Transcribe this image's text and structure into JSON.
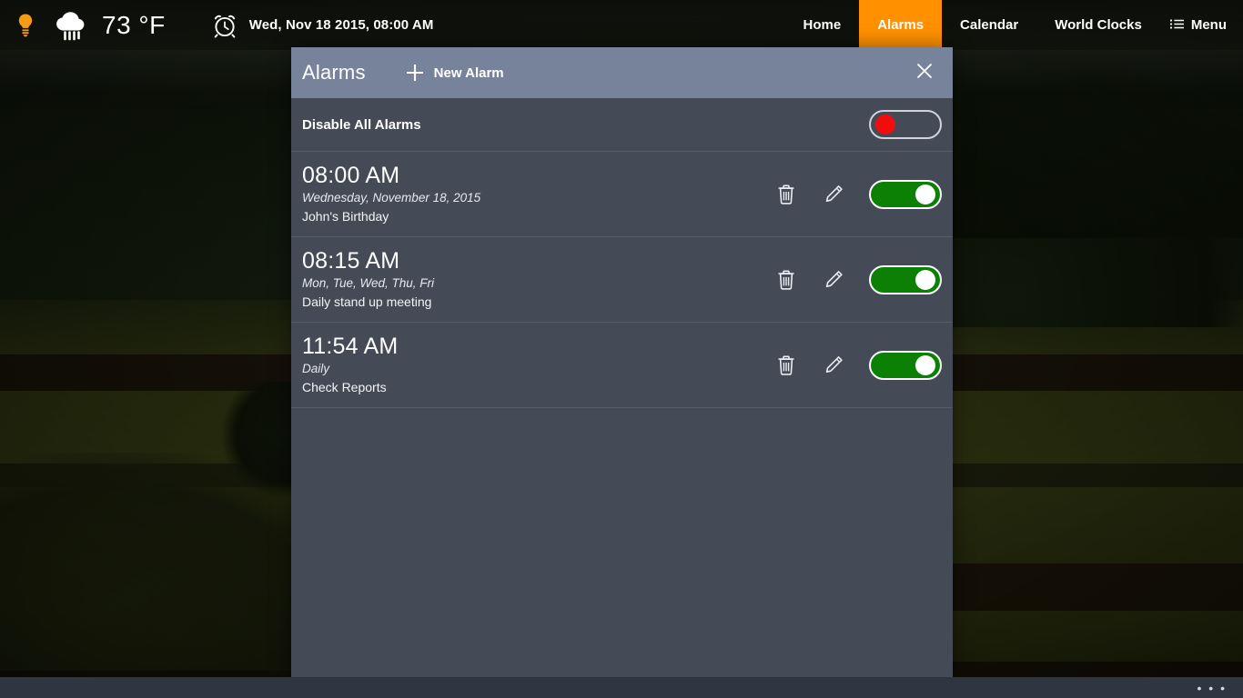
{
  "topbar": {
    "bulb_icon": "lightbulb-icon",
    "weather_icon": "rain-cloud-icon",
    "temperature": "73 °F",
    "clock_icon": "alarm-clock-icon",
    "datetime": "Wed, Nov 18 2015, 08:00 AM",
    "nav": [
      {
        "label": "Home",
        "active": false
      },
      {
        "label": "Alarms",
        "active": true
      },
      {
        "label": "Calendar",
        "active": false
      },
      {
        "label": "World Clocks",
        "active": false
      }
    ],
    "menu_label": "Menu",
    "menu_icon": "hamburger-menu-icon",
    "accent_color": "#ff9100"
  },
  "panel": {
    "title": "Alarms",
    "new_alarm_label": "New Alarm",
    "close_icon": "close-icon",
    "header_color": "#77839a",
    "body_color": "#444b57",
    "disable_all": {
      "label": "Disable All Alarms",
      "enabled": false,
      "knob_color": "#f20d0d"
    },
    "toggle_on_color": "#0b8005",
    "alarms": [
      {
        "time": "08:00 AM",
        "recurrence": "Wednesday, November 18, 2015",
        "label": "John's Birthday",
        "delete_icon": "trash-icon",
        "edit_icon": "pencil-icon",
        "enabled": true
      },
      {
        "time": "08:15 AM",
        "recurrence": "Mon, Tue, Wed, Thu, Fri",
        "label": "Daily stand up meeting",
        "delete_icon": "trash-icon",
        "edit_icon": "pencil-icon",
        "enabled": true
      },
      {
        "time": "11:54 AM",
        "recurrence": "Daily",
        "label": "Check Reports",
        "delete_icon": "trash-icon",
        "edit_icon": "pencil-icon",
        "enabled": true
      }
    ]
  },
  "bottombar": {
    "overflow_label": "• • •",
    "overflow_icon": "ellipsis-icon"
  }
}
